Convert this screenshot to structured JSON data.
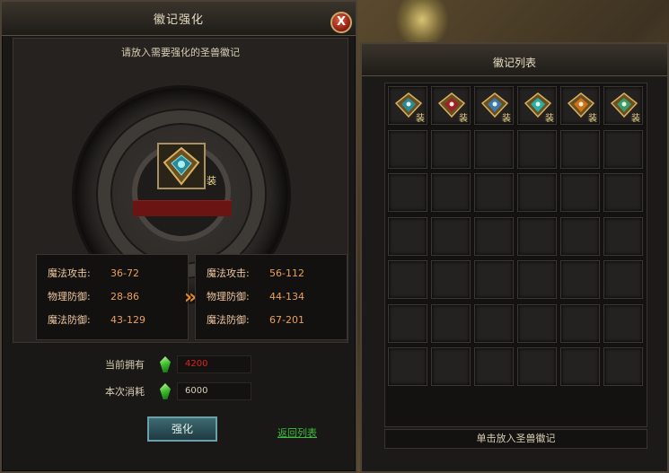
{
  "window": {
    "title": "徽记强化",
    "close_label": "X",
    "hint": "请放入需要强化的圣兽徽记",
    "socket_tag": "装"
  },
  "stats_current": [
    {
      "label": "魔法攻击:",
      "value": "36-72"
    },
    {
      "label": "物理防御:",
      "value": "28-86"
    },
    {
      "label": "魔法防御:",
      "value": "43-129"
    }
  ],
  "stats_next": [
    {
      "label": "魔法攻击:",
      "value": "56-112"
    },
    {
      "label": "物理防御:",
      "value": "44-134"
    },
    {
      "label": "魔法防御:",
      "value": "67-201"
    }
  ],
  "resources": {
    "owned_label": "当前拥有",
    "owned_value": "4200",
    "cost_label": "本次消耗",
    "cost_value": "6000"
  },
  "buttons": {
    "strengthen": "强化",
    "back": "返回列表"
  },
  "list": {
    "title": "徽记列表",
    "item_tag": "装",
    "footer": "单击放入圣兽徽记",
    "badges": [
      {
        "icon": "emblem-teal-icon",
        "color": "#2a8a9a"
      },
      {
        "icon": "emblem-red-icon",
        "color": "#a02028"
      },
      {
        "icon": "emblem-blue-icon",
        "color": "#3a7ab0"
      },
      {
        "icon": "emblem-cyan-icon",
        "color": "#28b0a8"
      },
      {
        "icon": "emblem-orange-icon",
        "color": "#d07018"
      },
      {
        "icon": "emblem-green-icon",
        "color": "#3a9a6a"
      }
    ]
  },
  "colors": {
    "owned_value": "#e02020",
    "cost_value": "#d8cdb5",
    "stat_label": "#f0c8a0",
    "link": "#3cbc3c"
  }
}
